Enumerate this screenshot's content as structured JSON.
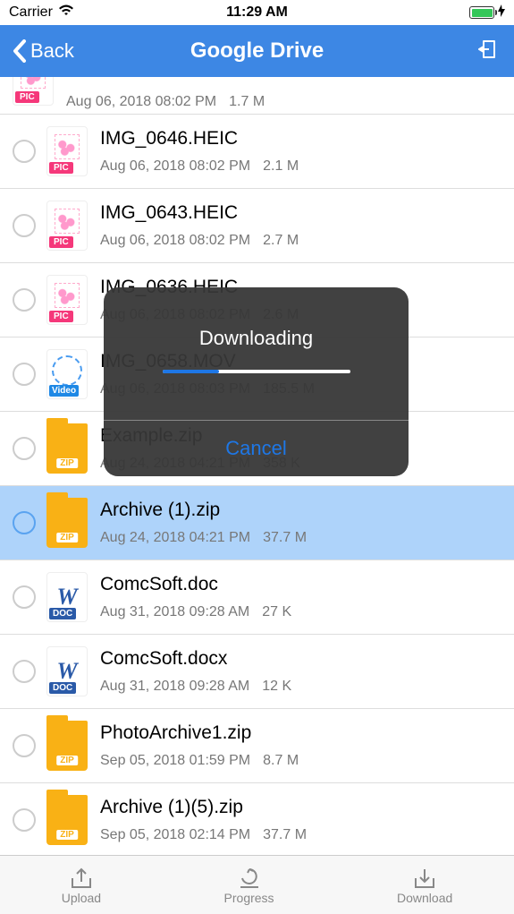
{
  "status": {
    "carrier": "Carrier",
    "time": "11:29 AM"
  },
  "nav": {
    "back": "Back",
    "title": "Google Drive"
  },
  "modal": {
    "title": "Downloading",
    "cancel": "Cancel"
  },
  "files": [
    {
      "name": "",
      "date": "Aug 06, 2018 08:02 PM",
      "size": "1.7 M",
      "type": "pic",
      "selected": false,
      "cut": true
    },
    {
      "name": "IMG_0646.HEIC",
      "date": "Aug 06, 2018 08:02 PM",
      "size": "2.1 M",
      "type": "pic",
      "selected": false
    },
    {
      "name": "IMG_0643.HEIC",
      "date": "Aug 06, 2018 08:02 PM",
      "size": "2.7 M",
      "type": "pic",
      "selected": false
    },
    {
      "name": "IMG_0636.HEIC",
      "date": "Aug 06, 2018 08:02 PM",
      "size": "2.6 M",
      "type": "pic",
      "selected": false
    },
    {
      "name": "IMG_0658.MOV",
      "date": "Aug 06, 2018 08:03 PM",
      "size": "185.5 M",
      "type": "video",
      "selected": false
    },
    {
      "name": "Example.zip",
      "date": "Aug 24, 2018 04:21 PM",
      "size": "358 K",
      "type": "zip",
      "selected": false
    },
    {
      "name": "Archive (1).zip",
      "date": "Aug 24, 2018 04:21 PM",
      "size": "37.7 M",
      "type": "zip",
      "selected": true
    },
    {
      "name": "ComcSoft.doc",
      "date": "Aug 31, 2018 09:28 AM",
      "size": "27 K",
      "type": "doc",
      "selected": false
    },
    {
      "name": "ComcSoft.docx",
      "date": "Aug 31, 2018 09:28 AM",
      "size": "12 K",
      "type": "doc",
      "selected": false
    },
    {
      "name": "PhotoArchive1.zip",
      "date": "Sep 05, 2018 01:59 PM",
      "size": "8.7 M",
      "type": "zip",
      "selected": false
    },
    {
      "name": "Archive (1)(5).zip",
      "date": "Sep 05, 2018 02:14 PM",
      "size": "37.7 M",
      "type": "zip",
      "selected": false
    }
  ],
  "tabs": {
    "upload": "Upload",
    "progress": "Progress",
    "download": "Download"
  }
}
